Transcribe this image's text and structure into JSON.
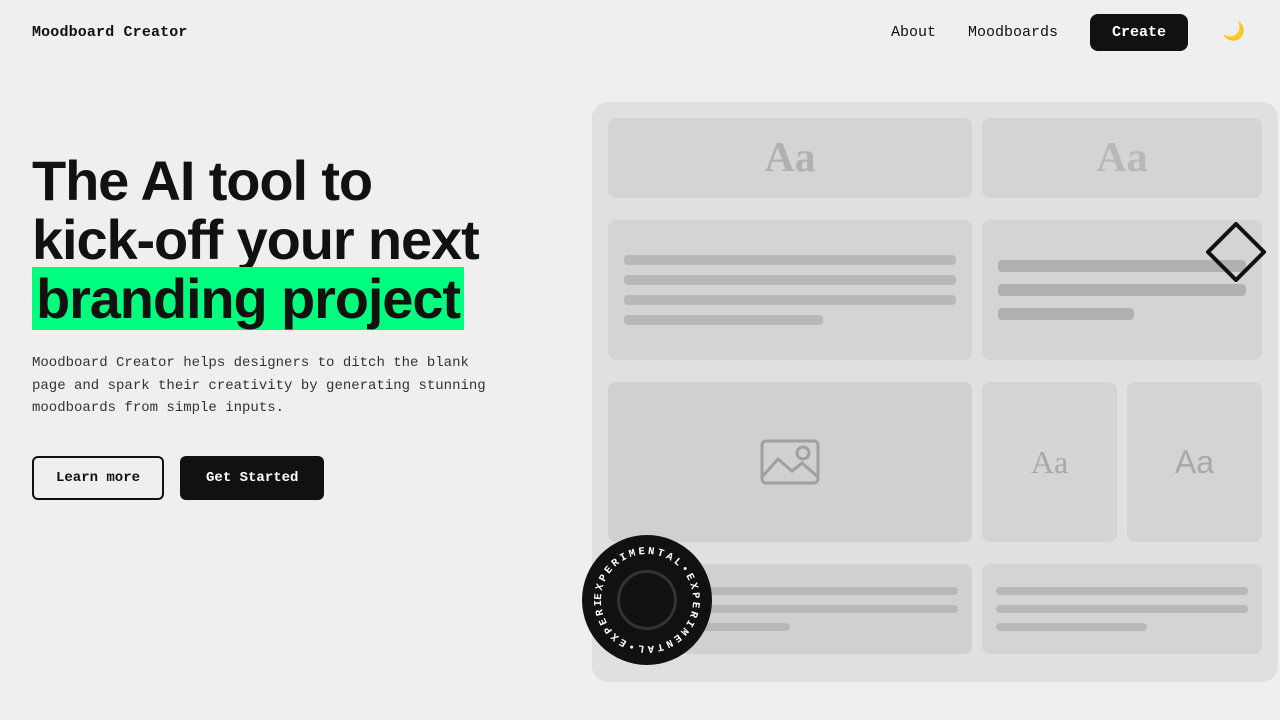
{
  "nav": {
    "logo": "Moodboard Creator",
    "links": [
      {
        "label": "About",
        "id": "about"
      },
      {
        "label": "Moodboards",
        "id": "moodboards"
      }
    ],
    "create_label": "Create",
    "theme_icon": "🌙"
  },
  "hero": {
    "heading_line1": "The AI tool to",
    "heading_line2": "kick-off your next",
    "heading_highlight": "branding project",
    "description": "Moodboard Creator helps designers to ditch the blank page and spark their creativity by generating stunning moodboards from simple inputs.",
    "btn_learn_more": "Learn more",
    "btn_get_started": "Get Started"
  },
  "moodboard": {
    "typo_label_1": "Aa",
    "typo_label_2": "Aa",
    "font_label_1": "Aa",
    "font_label_2": "Aa",
    "image_icon": "🖼",
    "badge_text": "EXPERIMENTAL•EXPERIMENTAL•EXPERIMENTAL•"
  },
  "icons": {
    "diamond": "◇",
    "moon": "🌙"
  }
}
